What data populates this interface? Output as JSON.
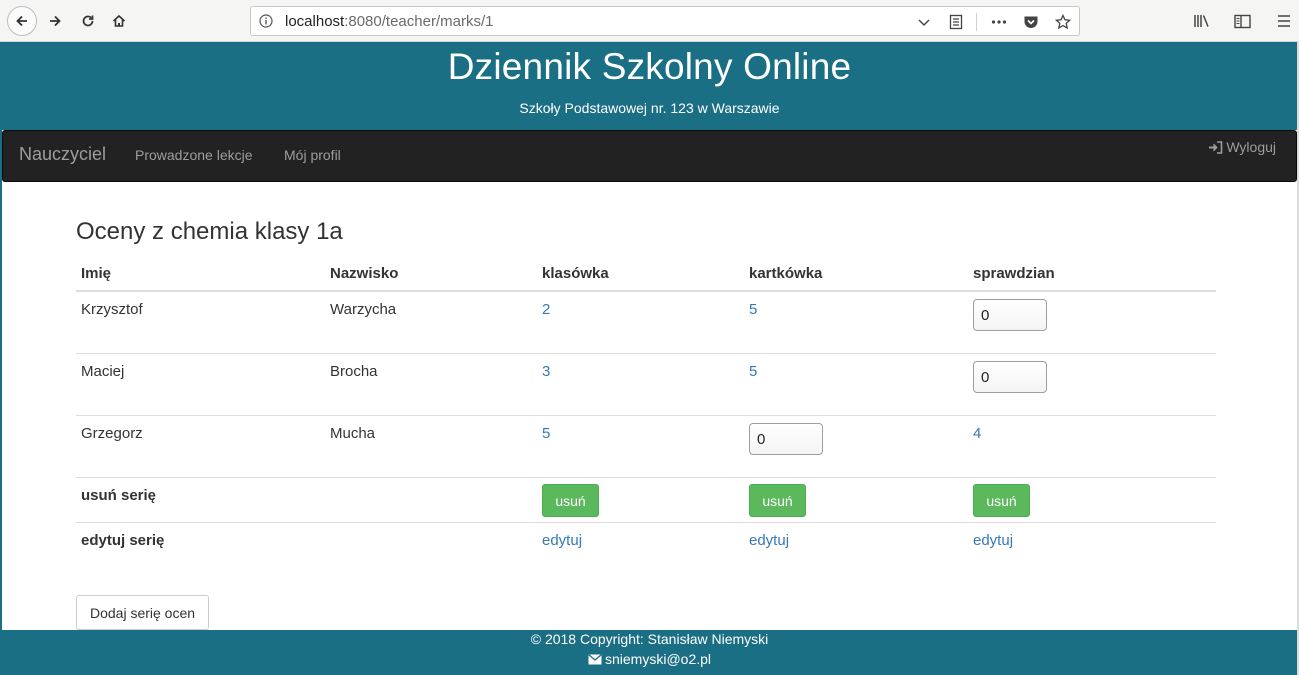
{
  "browser": {
    "url_host": "localhost",
    "url_path": ":8080/teacher/marks/1"
  },
  "header": {
    "title": "Dziennik Szkolny Online",
    "subtitle": "Szkoły Podstawowej nr. 123 w Warszawie",
    "color": "#1b6f84"
  },
  "navbar": {
    "brand": "Nauczyciel",
    "links": [
      "Prowadzone lekcje",
      "Mój profil"
    ],
    "logout": "Wyloguj"
  },
  "page": {
    "heading": "Oceny z chemia klasy 1a"
  },
  "table": {
    "headers": [
      "Imię",
      "Nazwisko",
      "klasówka",
      "kartkówka",
      "sprawdzian"
    ],
    "rows": [
      {
        "first_name": "Krzysztof",
        "last_name": "Warzycha",
        "klasowka": "2",
        "kartkowka": "5",
        "sprawdzian_input": "0"
      },
      {
        "first_name": "Maciej",
        "last_name": "Brocha",
        "klasowka": "3",
        "kartkowka": "5",
        "sprawdzian_input": "0"
      },
      {
        "first_name": "Grzegorz",
        "last_name": "Mucha",
        "klasowka": "5",
        "kartkowka_input": "0",
        "sprawdzian": "4"
      }
    ],
    "delete_row_label": "usuń serię",
    "delete_button": "usuń",
    "edit_row_label": "edytuj serię",
    "edit_link": "edytuj",
    "accent_button_color": "#5cb85c",
    "link_color": "#337ab7"
  },
  "add_series_button": "Dodaj serię ocen",
  "footer": {
    "copyright": "© 2018 Copyright: Stanisław Niemyski",
    "email": "sniemyski@o2.pl"
  }
}
